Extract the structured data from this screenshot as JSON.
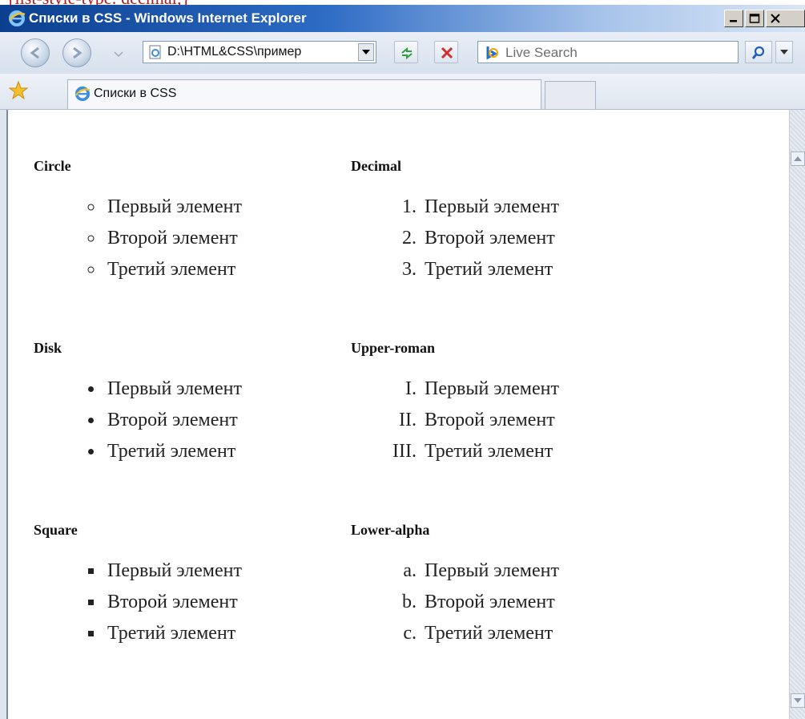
{
  "clipped_text": "{list-style-type: decimal;}",
  "window": {
    "title": "Списки в CSS - Windows Internet Explorer"
  },
  "nav": {
    "address": "D:\\HTML&CSS\\пример",
    "search_placeholder": "Live Search"
  },
  "tabs": [
    {
      "label": "Списки в CSS"
    }
  ],
  "content": {
    "sections_left": [
      {
        "title": "Circle",
        "style": "circle",
        "items": [
          "Первый элемент",
          "Второй элемент",
          "Третий элемент"
        ]
      },
      {
        "title": "Disk",
        "style": "disc",
        "items": [
          "Первый элемент",
          "Второй элемент",
          "Третий элемент"
        ]
      },
      {
        "title": "Square",
        "style": "square",
        "items": [
          "Первый элемент",
          "Второй элемент",
          "Третий элемент"
        ]
      }
    ],
    "sections_right": [
      {
        "title": "Decimal",
        "style": "decimal",
        "items": [
          "Первый элемент",
          "Второй элемент",
          "Третий элемент"
        ]
      },
      {
        "title": "Upper-roman",
        "style": "upper-roman",
        "items": [
          "Первый элемент",
          "Второй элемент",
          "Третий элемент"
        ]
      },
      {
        "title": "Lower-alpha",
        "style": "lower-alpha",
        "items": [
          "Первый элемент",
          "Второй элемент",
          "Третий элемент"
        ]
      }
    ]
  },
  "colors": {
    "titlebar_start": "#0b3f8f",
    "titlebar_end": "#d9e6f6",
    "clipped_text": "#b01c1c",
    "close_x": "#d22c2c"
  },
  "icons": {
    "title": "ie-logo-icon",
    "back": "back-arrow-icon",
    "forward": "forward-arrow-icon",
    "refresh": "refresh-icon",
    "stop": "stop-icon",
    "search_logo": "bing-logo-icon",
    "search": "magnifier-icon",
    "favorites": "star-icon"
  }
}
